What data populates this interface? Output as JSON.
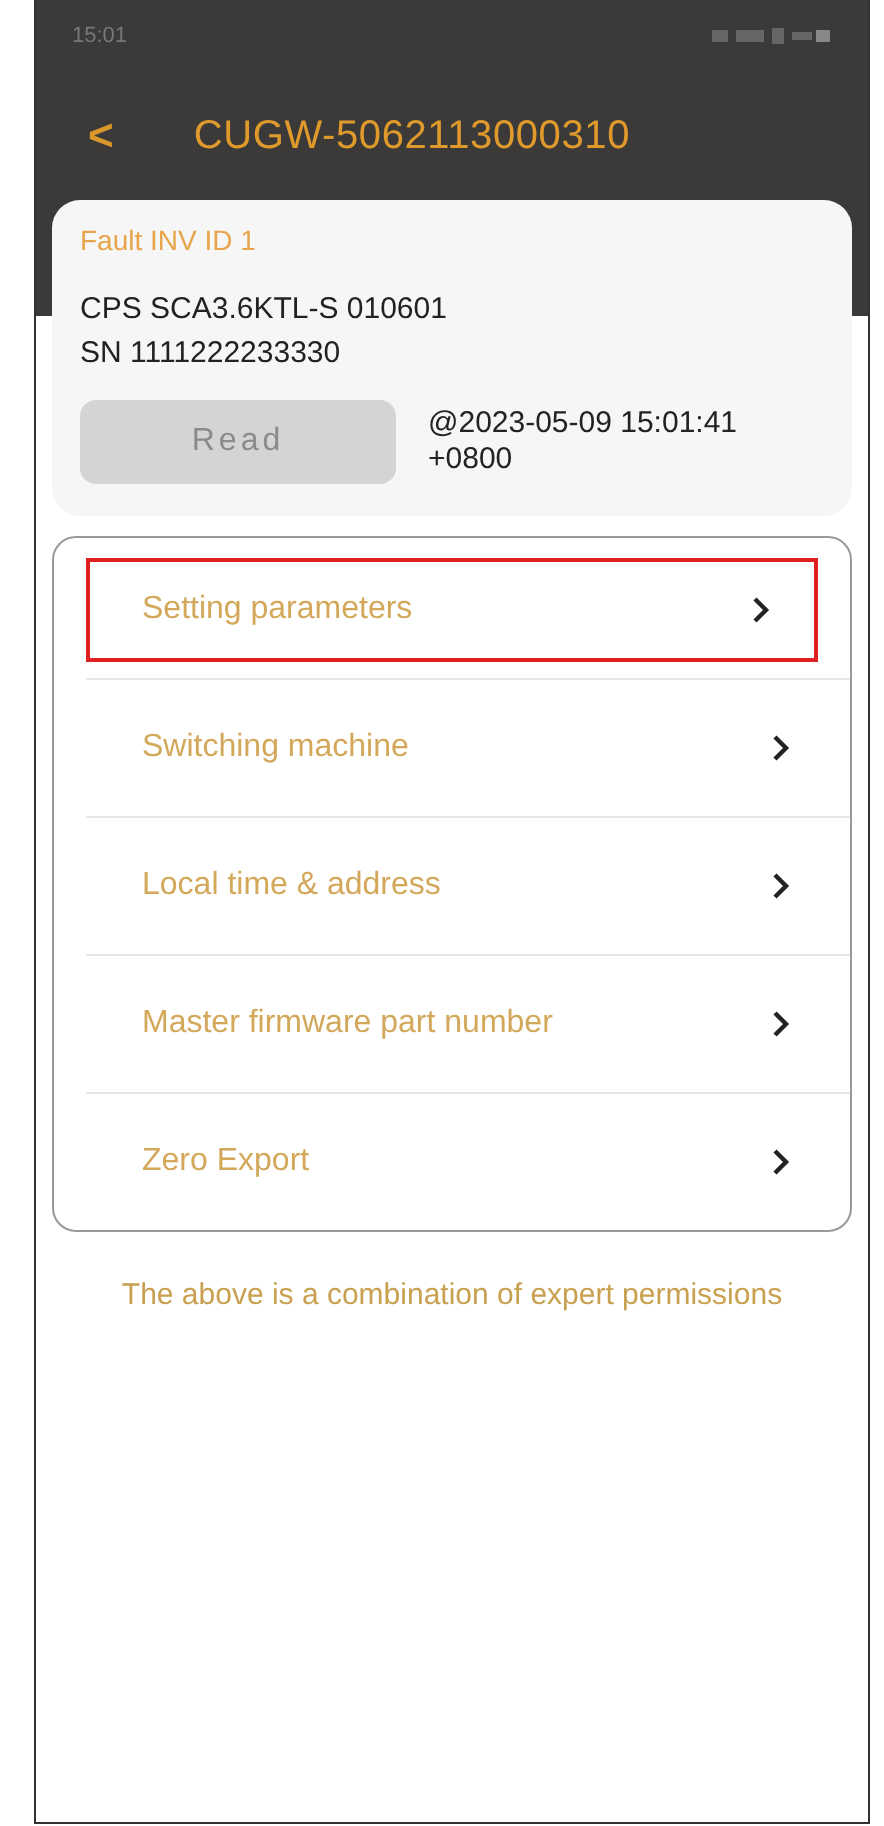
{
  "status_bar": {
    "time": "15:01"
  },
  "header": {
    "back": "<",
    "title": "CUGW-5062113000310"
  },
  "device": {
    "fault_label": "Fault INV ID 1",
    "model": "CPS SCA3.6KTL-S 010601",
    "serial": "SN 1111222233330",
    "read_button": {
      "label": "Read",
      "disabled": true
    },
    "timestamp": "@2023-05-09 15:01:41 +0800"
  },
  "menu": [
    {
      "label": "Setting parameters",
      "selected": true
    },
    {
      "label": "Switching machine",
      "selected": false
    },
    {
      "label": "Local time & address",
      "selected": false
    },
    {
      "label": "Master firmware part number",
      "selected": false
    },
    {
      "label": "Zero Export",
      "selected": false
    }
  ],
  "note": "The above is a combination of expert permissions"
}
